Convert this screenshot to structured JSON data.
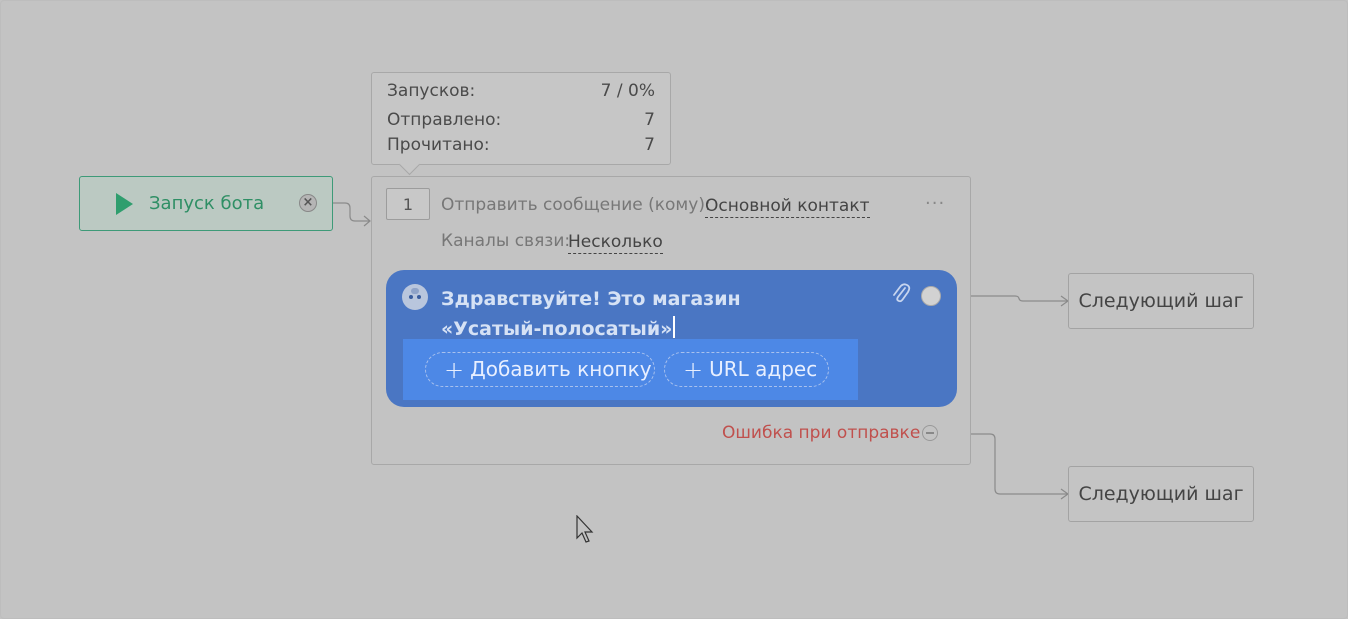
{
  "stats": {
    "launches_label": "Запусков:",
    "launches_value": "7 / 0%",
    "sent_label": "Отправлено:",
    "sent_value": "7",
    "read_label": "Прочитано:",
    "read_value": "7"
  },
  "start_node": {
    "label": "Запуск бота",
    "play_icon": "play-icon",
    "close_icon": "close-icon",
    "close_glyph": "×"
  },
  "message_node": {
    "step_number": "1",
    "send_label": "Отправить сообщение (кому):",
    "recipient": "Основной контакт",
    "more_glyph": "···",
    "channels_label": "Каналы связи:",
    "channels_value": "Несколько",
    "message_text": "Здравствуйте! Это магазин «Усатый-полосатый»",
    "buttons": [
      {
        "plus": "+",
        "label": "Добавить кнопку"
      },
      {
        "plus": "+",
        "label": "URL адрес"
      }
    ],
    "error_label": "Ошибка при отправке"
  },
  "next_steps": [
    {
      "label": "Следующий шаг"
    },
    {
      "label": "Следующий шаг"
    }
  ],
  "colors": {
    "background": "#c3c3c3",
    "start_accent": "#2f9e6e",
    "bubble": "#4a76c3",
    "buttons_area": "#4d88e6",
    "error": "#c0504d"
  }
}
